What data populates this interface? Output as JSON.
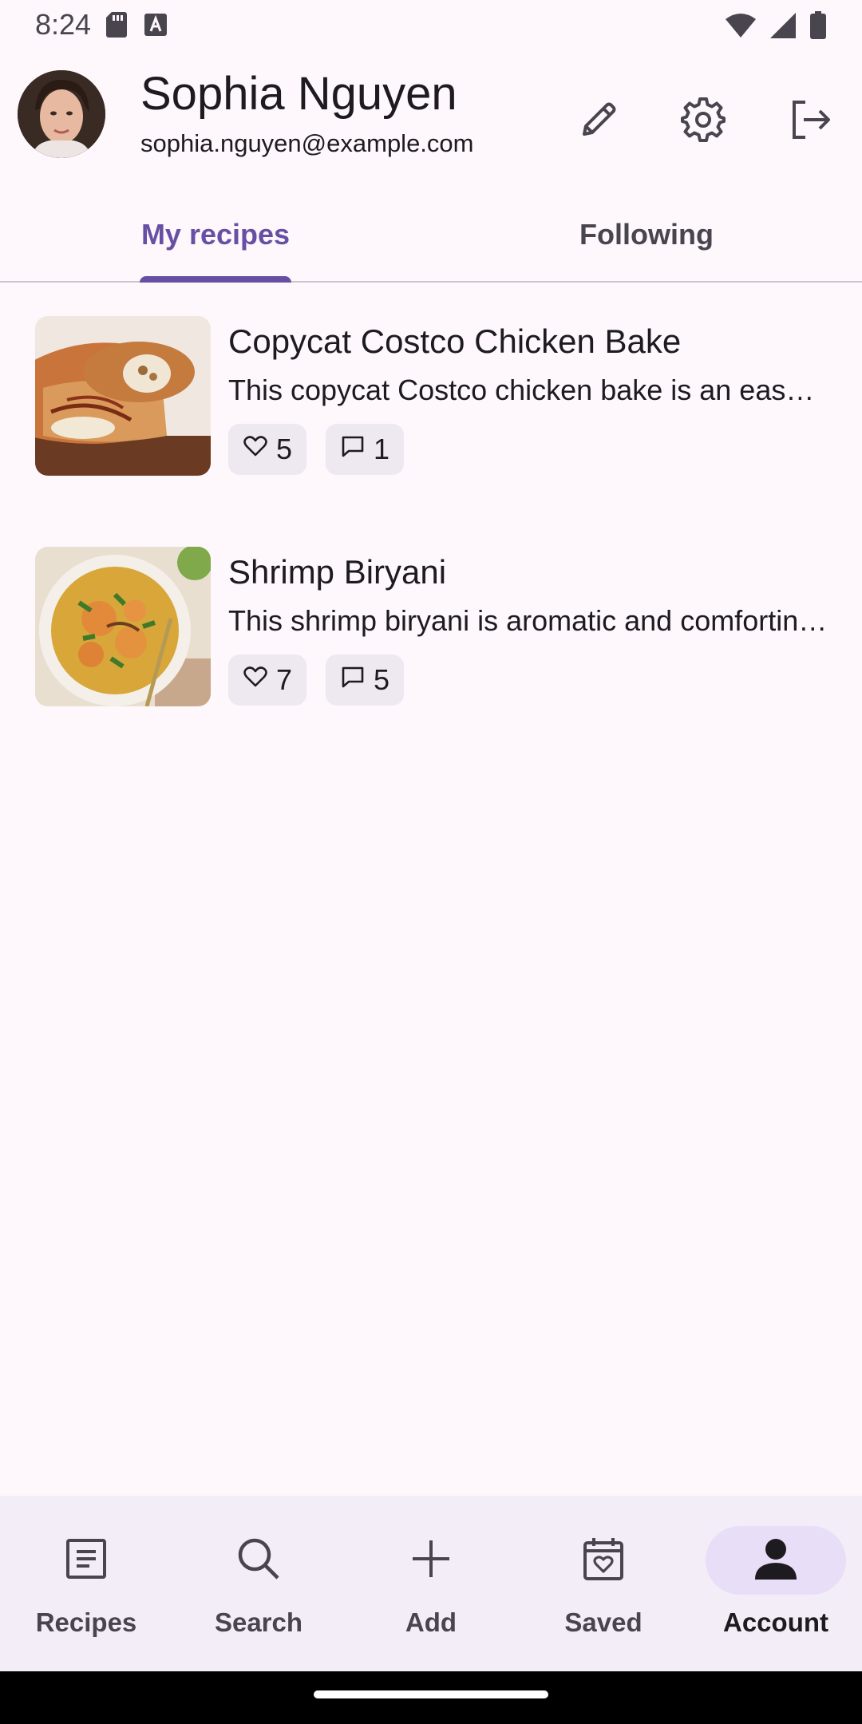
{
  "status_bar": {
    "time": "8:24",
    "icons": [
      "sd-card-icon",
      "font-a-icon",
      "wifi-icon",
      "signal-icon",
      "battery-icon"
    ]
  },
  "profile": {
    "name": "Sophia Nguyen",
    "email": "sophia.nguyen@example.com",
    "actions": [
      "edit-icon",
      "settings-icon",
      "logout-icon"
    ]
  },
  "tabs": [
    {
      "label": "My recipes",
      "active": true
    },
    {
      "label": "Following",
      "active": false
    }
  ],
  "recipes": [
    {
      "title": "Copycat Costco Chicken Bake",
      "description": "This copycat Costco chicken bake is an easy homemade version of the food court favorite",
      "likes": "5",
      "comments": "1"
    },
    {
      "title": "Shrimp Biryani",
      "description": "This shrimp biryani is aromatic and comforting, layered with spiced rice and shrimp",
      "likes": "7",
      "comments": "5"
    }
  ],
  "bottom_nav": [
    {
      "label": "Recipes",
      "icon": "recipes-icon",
      "active": false
    },
    {
      "label": "Search",
      "icon": "search-icon",
      "active": false
    },
    {
      "label": "Add",
      "icon": "add-icon",
      "active": false
    },
    {
      "label": "Saved",
      "icon": "saved-icon",
      "active": false
    },
    {
      "label": "Account",
      "icon": "account-icon",
      "active": true
    }
  ],
  "colors": {
    "primary": "#6750A4",
    "background": "#FEF7FC",
    "nav_background": "#F3EDF7",
    "active_indicator": "#E8DEF8",
    "chip": "#EEE8F0"
  }
}
